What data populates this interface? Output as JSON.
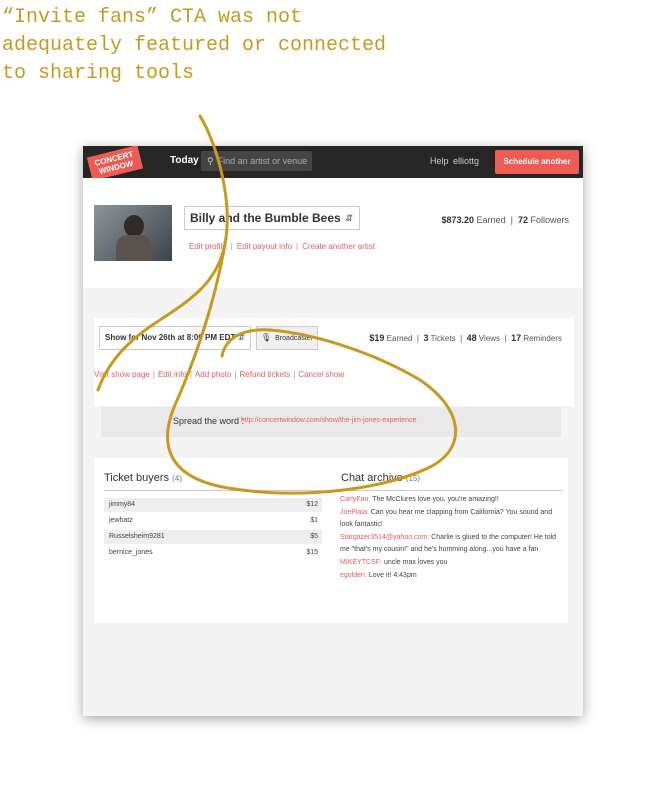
{
  "annotation": {
    "caption": "“Invite fans” CTA was not\nadequately featured or connected\nto sharing tools",
    "highlight_color": "#c79a1f"
  },
  "header": {
    "logo_line1": "CONCERT",
    "logo_line2": "WINDOW",
    "nav_today": "Today",
    "search_placeholder": "Find an artist or venue",
    "help": "Help",
    "username": "elliottg",
    "cta_label": "Schedule another show"
  },
  "artist": {
    "name": "Billy and the Bumble Bees",
    "links": [
      "Edit profile",
      "Edit payout info",
      "Create another artist"
    ],
    "earned_value": "$873.20",
    "earned_label": "Earned",
    "followers_value": "72",
    "followers_label": "Followers"
  },
  "show": {
    "selected": "Show for Nov 26th at 8:00 PM EDT",
    "broadcast_label": "Broadcaster",
    "stats": {
      "earned_value": "$19",
      "earned_label": "Earned",
      "tickets_value": "3",
      "tickets_label": "Tickets",
      "views_value": "48",
      "views_label": "Views",
      "reminders_value": "17",
      "reminders_label": "Reminders"
    },
    "links": [
      "Visit show page",
      "Edit info",
      "Add photo",
      "Refund tickets",
      "Cancel show"
    ]
  },
  "spread": {
    "label": "Spread the word :",
    "url": "http://concertwindow.com/show/the-jim-jones-experience"
  },
  "ticket_buyers": {
    "title": "Ticket buyers",
    "count": "(4)",
    "rows": [
      {
        "name": "jimmy84",
        "amount": "$12"
      },
      {
        "name": "jewhatz",
        "amount": "$1"
      },
      {
        "name": "Russelsheim9281",
        "amount": "$5"
      },
      {
        "name": "bernice_jones",
        "amount": "$15"
      }
    ]
  },
  "chat": {
    "title": "Chat archive",
    "count": "(15)",
    "messages": [
      {
        "user": "CarlyFan:",
        "text": "The McClures love you, you're amazing!!"
      },
      {
        "user": "JoePlaia:",
        "text": "Can you hear me clapping from California? You sound and look fantastic!"
      },
      {
        "user": "Stargazer3514@yahoo.com:",
        "text": "Charlie is glued to the computer! He told me \"that's my cousin!\" and he's humming along...you have a fan"
      },
      {
        "user": "MIKEYTCSF:",
        "text": "uncle max loves you"
      },
      {
        "user": "egolden:",
        "text": "Love it! 4:43pm"
      }
    ]
  }
}
